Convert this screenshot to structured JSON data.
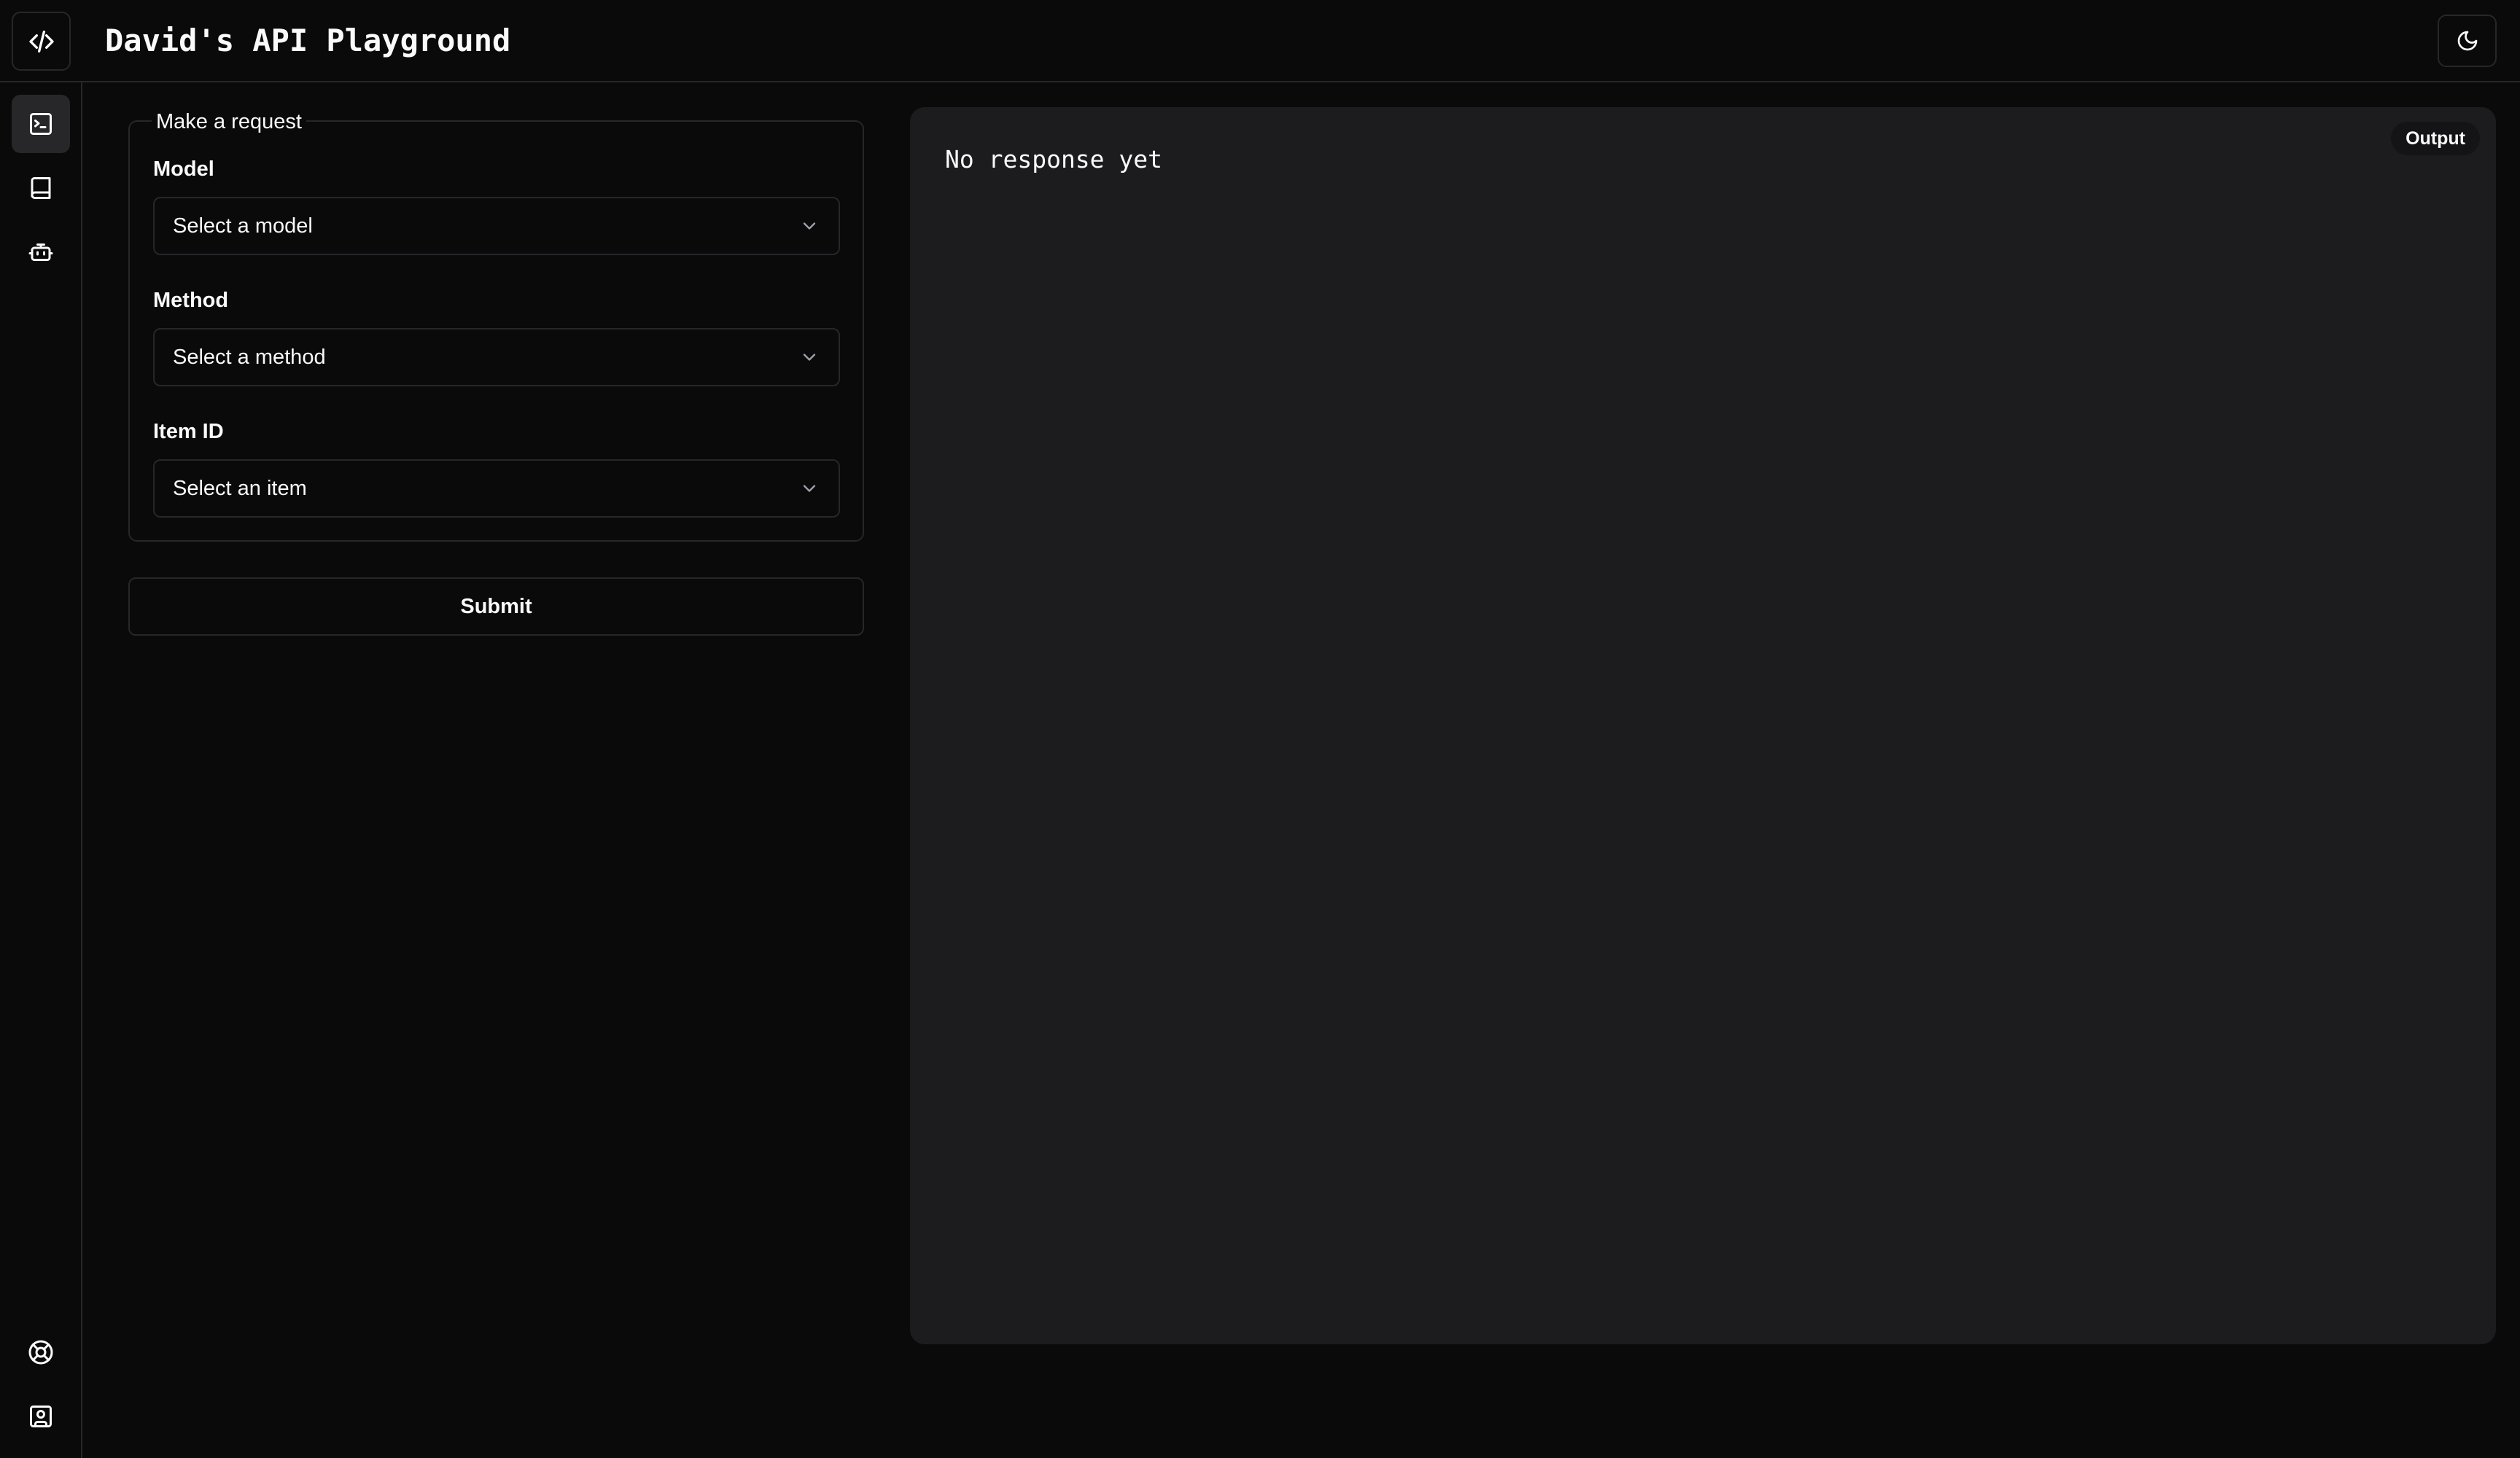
{
  "header": {
    "title": "David's API Playground",
    "logo_icon": "code-icon",
    "theme_icon": "moon-icon"
  },
  "sidebar": {
    "items": [
      {
        "name": "terminal",
        "icon": "terminal-icon",
        "active": true
      },
      {
        "name": "docs",
        "icon": "book-icon",
        "active": false
      },
      {
        "name": "bot",
        "icon": "bot-icon",
        "active": false
      }
    ],
    "bottom_items": [
      {
        "name": "help",
        "icon": "life-buoy-icon"
      },
      {
        "name": "account",
        "icon": "user-square-icon"
      }
    ]
  },
  "request_form": {
    "legend": "Make a request",
    "model": {
      "label": "Model",
      "placeholder": "Select a model"
    },
    "method": {
      "label": "Method",
      "placeholder": "Select a method"
    },
    "item_id": {
      "label": "Item ID",
      "placeholder": "Select an item"
    },
    "submit_label": "Submit"
  },
  "output": {
    "badge": "Output",
    "response_text": "No response yet"
  },
  "colors": {
    "background": "#0a0a0b",
    "panel": "#1c1c1f",
    "border": "#27272a",
    "text": "#fafafa"
  }
}
